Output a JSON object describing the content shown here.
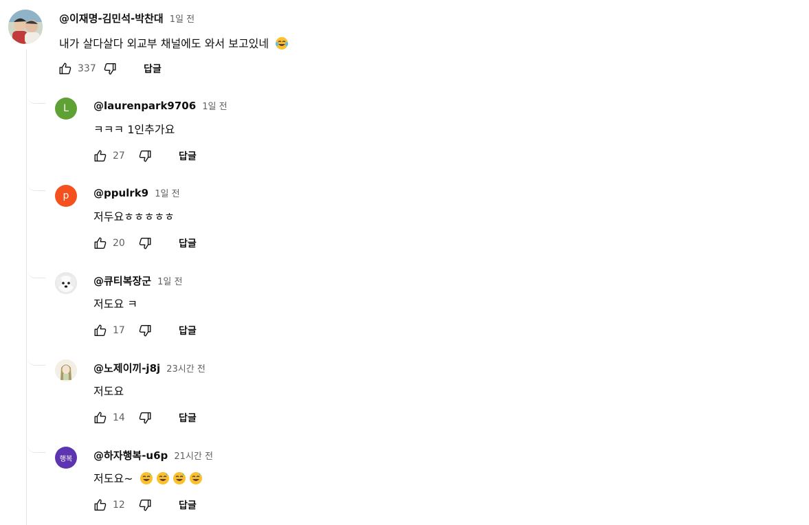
{
  "top_comment": {
    "author": "@이재명-김민석-박찬대",
    "time": "1일 전",
    "text": "내가 살다살다 외교부 채널에도 와서 보고있네",
    "text_emoji": "laughing-tears-emoji",
    "likes": "337",
    "reply_label": "답글"
  },
  "replies": [
    {
      "author": "@laurenpark9706",
      "time": "1일 전",
      "text": "ㅋㅋㅋ 1인추가요",
      "likes": "27",
      "reply_label": "답글",
      "avatar_letter": "L",
      "avatar_color": "#5fa135"
    },
    {
      "author": "@ppulrk9",
      "time": "1일 전",
      "text": "저두요ㅎㅎㅎㅎㅎ",
      "likes": "20",
      "reply_label": "답글",
      "avatar_letter": "p",
      "avatar_color": "#f4511e"
    },
    {
      "author": "@큐티복장군",
      "time": "1일 전",
      "text": "저도요 ㅋ",
      "likes": "17",
      "reply_label": "답글",
      "avatar_icon": "white-dog-photo"
    },
    {
      "author": "@노제이끼-j8j",
      "time": "23시간 전",
      "text": "저도요",
      "likes": "14",
      "reply_label": "답글",
      "avatar_icon": "illustrated-girl-photo"
    },
    {
      "author": "@하자행복-u6p",
      "time": "21시간 전",
      "text": "저도요~",
      "text_emoji": "grinning-sweat-emoji x4",
      "likes": "12",
      "reply_label": "답글",
      "avatar_letter": "행복",
      "avatar_color": "#5e35b1"
    }
  ],
  "icons": {
    "like": "thumbs-up-icon",
    "dislike": "thumbs-down-icon"
  }
}
